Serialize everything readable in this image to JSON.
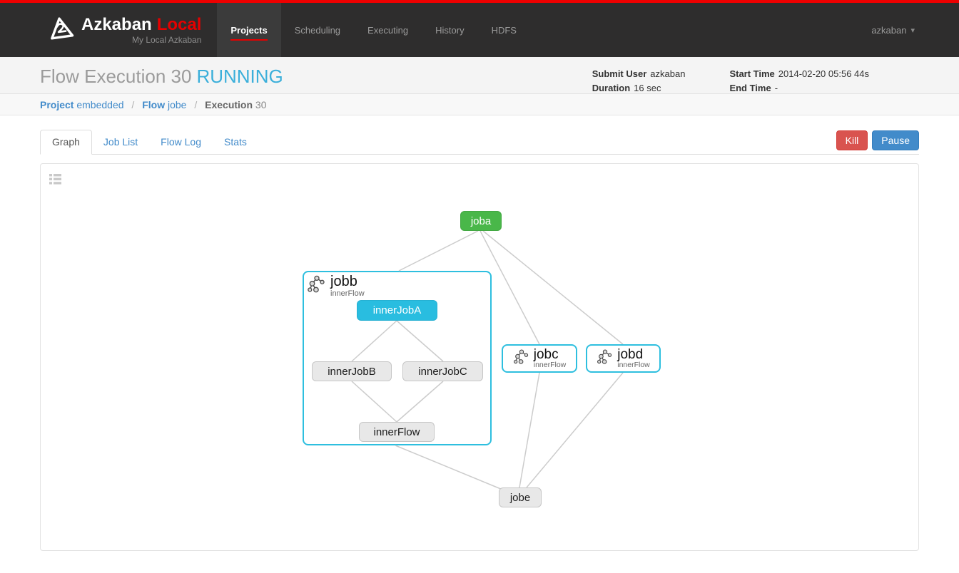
{
  "navbar": {
    "brand": "Azkaban",
    "brand_accent": "Local",
    "subtitle": "My Local Azkaban",
    "items": [
      {
        "label": "Projects",
        "active": true
      },
      {
        "label": "Scheduling"
      },
      {
        "label": "Executing"
      },
      {
        "label": "History"
      },
      {
        "label": "HDFS"
      }
    ],
    "user": "azkaban",
    "caret": "▾"
  },
  "header": {
    "title": "Flow Execution 30",
    "status": "RUNNING",
    "submit_user_label": "Submit User",
    "submit_user": "azkaban",
    "duration_label": "Duration",
    "duration": "16 sec",
    "start_time_label": "Start Time",
    "start_time": "2014-02-20 05:56 44s",
    "end_time_label": "End Time",
    "end_time": "-"
  },
  "breadcrumb": {
    "project_label": "Project",
    "project": "embedded",
    "flow_label": "Flow",
    "flow": "jobe",
    "execution_label": "Execution",
    "execution": "30",
    "separator": "/"
  },
  "tabs": {
    "items": [
      {
        "label": "Graph",
        "active": true
      },
      {
        "label": "Job List"
      },
      {
        "label": "Flow Log"
      },
      {
        "label": "Stats"
      }
    ]
  },
  "actions": {
    "kill": "Kill",
    "pause": "Pause"
  },
  "graph": {
    "nodes": {
      "joba": {
        "label": "joba"
      },
      "jobb": {
        "label": "jobb",
        "type": "innerFlow"
      },
      "innerJobA": {
        "label": "innerJobA"
      },
      "innerJobB": {
        "label": "innerJobB"
      },
      "innerJobC": {
        "label": "innerJobC"
      },
      "innerFlow": {
        "label": "innerFlow"
      },
      "jobc": {
        "label": "jobc",
        "type": "innerFlow"
      },
      "jobd": {
        "label": "jobd",
        "type": "innerFlow"
      },
      "jobe": {
        "label": "jobe"
      }
    }
  },
  "colors": {
    "topbar_red": "#ee0000",
    "success_green": "#49b749",
    "running_cyan": "#29bde0",
    "flow_border_cyan": "#2ebfdf",
    "status_text_blue": "#3bafda",
    "link_blue": "#428bca",
    "kill_red": "#d9534f",
    "pause_blue": "#428bca",
    "edge_gray": "#cccccc"
  }
}
